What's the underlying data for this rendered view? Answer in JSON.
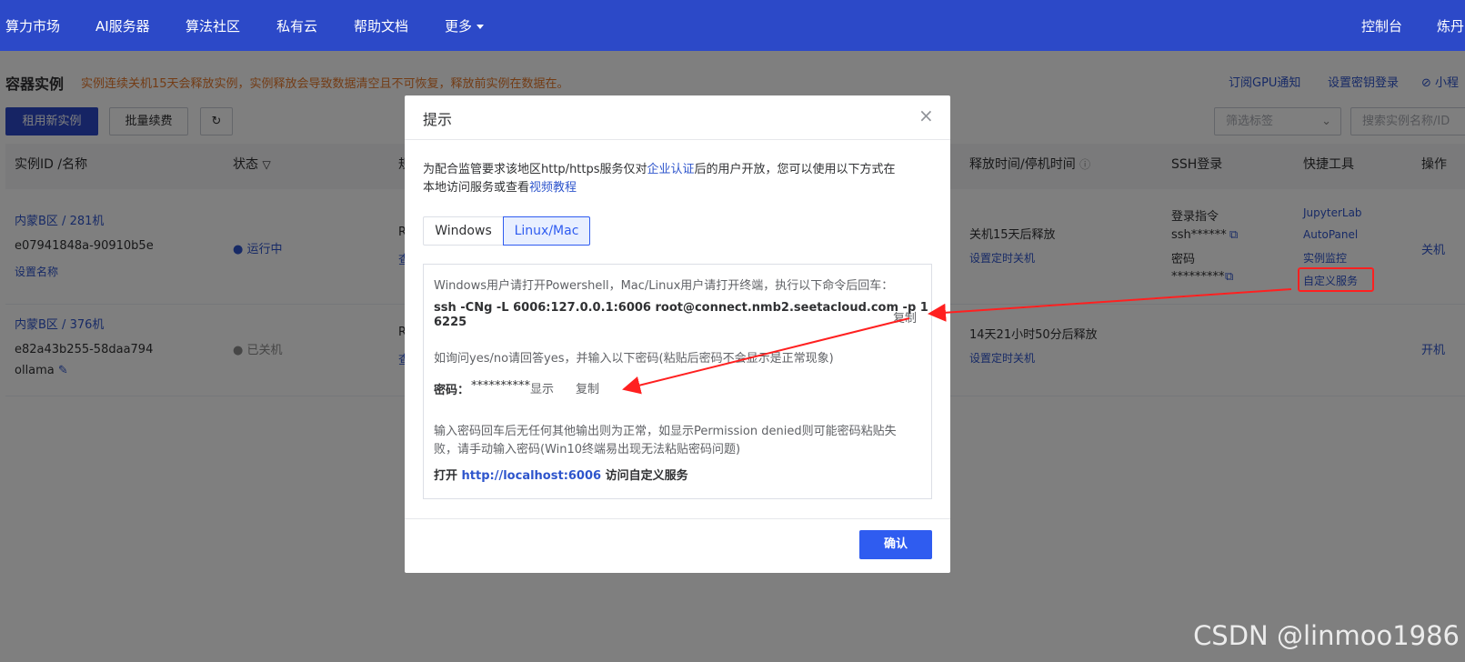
{
  "nav": {
    "items": [
      "算力市场",
      "AI服务器",
      "算法社区",
      "私有云",
      "帮助文档",
      "更多"
    ],
    "right": [
      "控制台",
      "炼丹"
    ]
  },
  "page": {
    "title": "容器实例",
    "notice": "实例连续关机15天会释放实例，实例释放会导致数据清空且不可恢复，释放前实例在数据在。",
    "links": [
      "订阅GPU通知",
      "设置密钥登录",
      "小程"
    ],
    "buttons": {
      "rent": "租用新实例",
      "renew": "批量续费"
    },
    "filter_placeholder": "筛选标签",
    "search_placeholder": "搜索实例名称/ID"
  },
  "table": {
    "headers": [
      "实例ID /名称",
      "状态",
      "规",
      "释放时间/停机时间",
      "SSH登录",
      "快捷工具",
      "操作"
    ],
    "rows": [
      {
        "region": "内蒙B区 / 281机",
        "id": "e07941848a-90910b5e",
        "name": "设置名称",
        "status": "运行中",
        "spec": "R",
        "spec2": "查",
        "release": "关机15天后释放",
        "release_action": "设置定时关机",
        "ssh_cmd_label": "登录指令",
        "ssh_cmd": "ssh******",
        "ssh_pwd_label": "密码",
        "ssh_pwd": "*********",
        "tools": [
          "JupyterLab",
          "AutoPanel",
          "实例监控",
          "自定义服务"
        ],
        "action": "关机"
      },
      {
        "region": "内蒙B区 / 376机",
        "id": "e82a43b255-58daa794",
        "name": "ollama",
        "status": "已关机",
        "spec": "R",
        "spec2": "查",
        "release": "14天21小时50分后释放",
        "release_action": "设置定时关机",
        "action": "开机"
      }
    ]
  },
  "modal": {
    "title": "提示",
    "intro_1": "为配合监管要求该地区http/https服务仅对",
    "intro_link1": "企业认证",
    "intro_2": "后的用户开放，您可以使用以下方式在",
    "intro_3": "本地访问服务或查看",
    "intro_link2": "视频教程",
    "tabs": [
      "Windows",
      "Linux/Mac"
    ],
    "active_tab": "Linux/Mac",
    "instructions": "Windows用户请打开Powershell，Mac/Linux用户请打开终端，执行以下命令后回车：",
    "command_line1": "ssh -CNg -L 6006:127.0.0.1:6006 root@connect.nmb2.seetacloud.com -p 1",
    "command_line2": "6225",
    "copy_label": "复制",
    "yesno_hint": "如询问yes/no请回答yes，并输入以下密码(粘贴后密码不会显示是正常现象)",
    "password_label": "密码：",
    "password_mask": "**********",
    "show_label": "显示",
    "copy_label2": "复制",
    "after_1": "输入密码回车后无任何其他输出则为正常，如显示Permission denied则可能密码粘贴失",
    "after_2": "败，请手动输入密码(Win10终端易出现无法粘贴密码问题)",
    "open_prefix": "打开",
    "open_url": "http://localhost:6006",
    "open_suffix": "访问自定义服务",
    "confirm": "确认"
  },
  "watermark": "CSDN @linmoo1986",
  "colors": {
    "nav_bg": "#2c49c8",
    "link": "#2e55cc",
    "notice": "#e6782b",
    "primary": "#2f5cf0",
    "annotation": "#ff2020"
  }
}
